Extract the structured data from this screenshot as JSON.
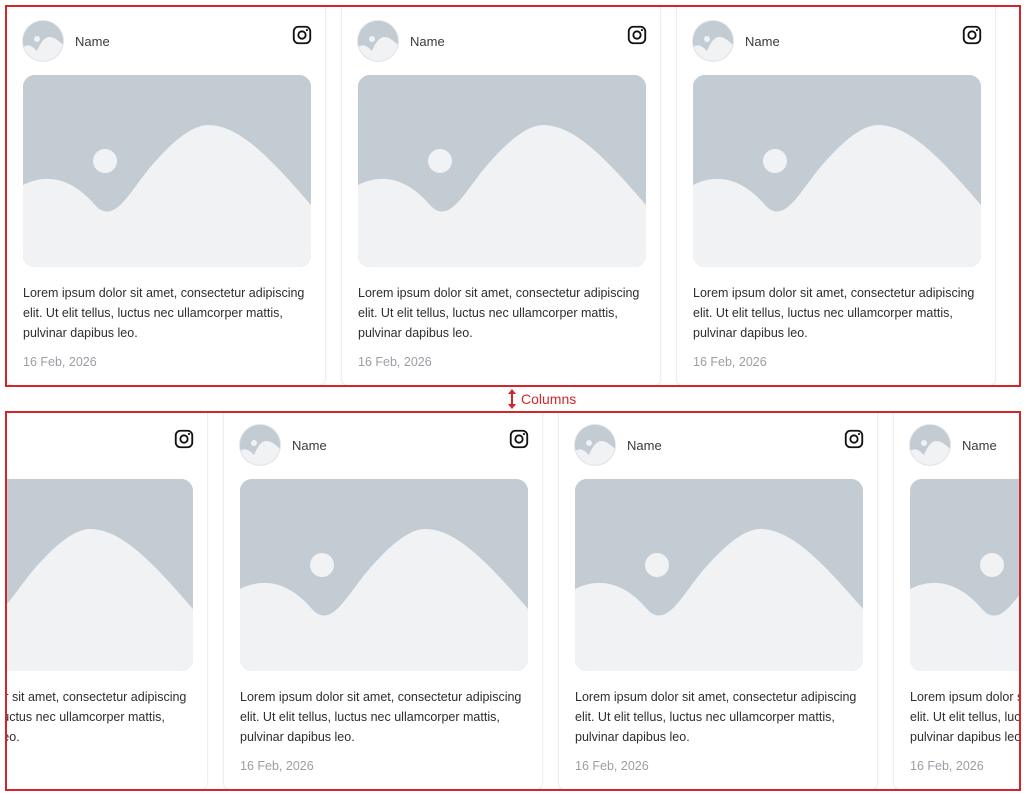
{
  "cards": [
    {
      "name": "Name",
      "text": "Lorem ipsum dolor sit amet, consectetur adipiscing elit. Ut elit tellus, luctus nec ullamcorper mattis, pulvinar dapibus leo.",
      "date": "16 Feb, 2026"
    }
  ],
  "label": "Columns",
  "icons": {
    "avatar": "person-placeholder-icon",
    "social": "instagram-icon",
    "image": "image-placeholder-icon",
    "spacing": "vertical-double-arrow-icon"
  },
  "colors": {
    "accent": "#d3262b",
    "placeholder": "#c3cbd3",
    "placeholder_light": "#f1f2f4",
    "text": "#2d2d2d",
    "muted": "#9a9ea3"
  }
}
